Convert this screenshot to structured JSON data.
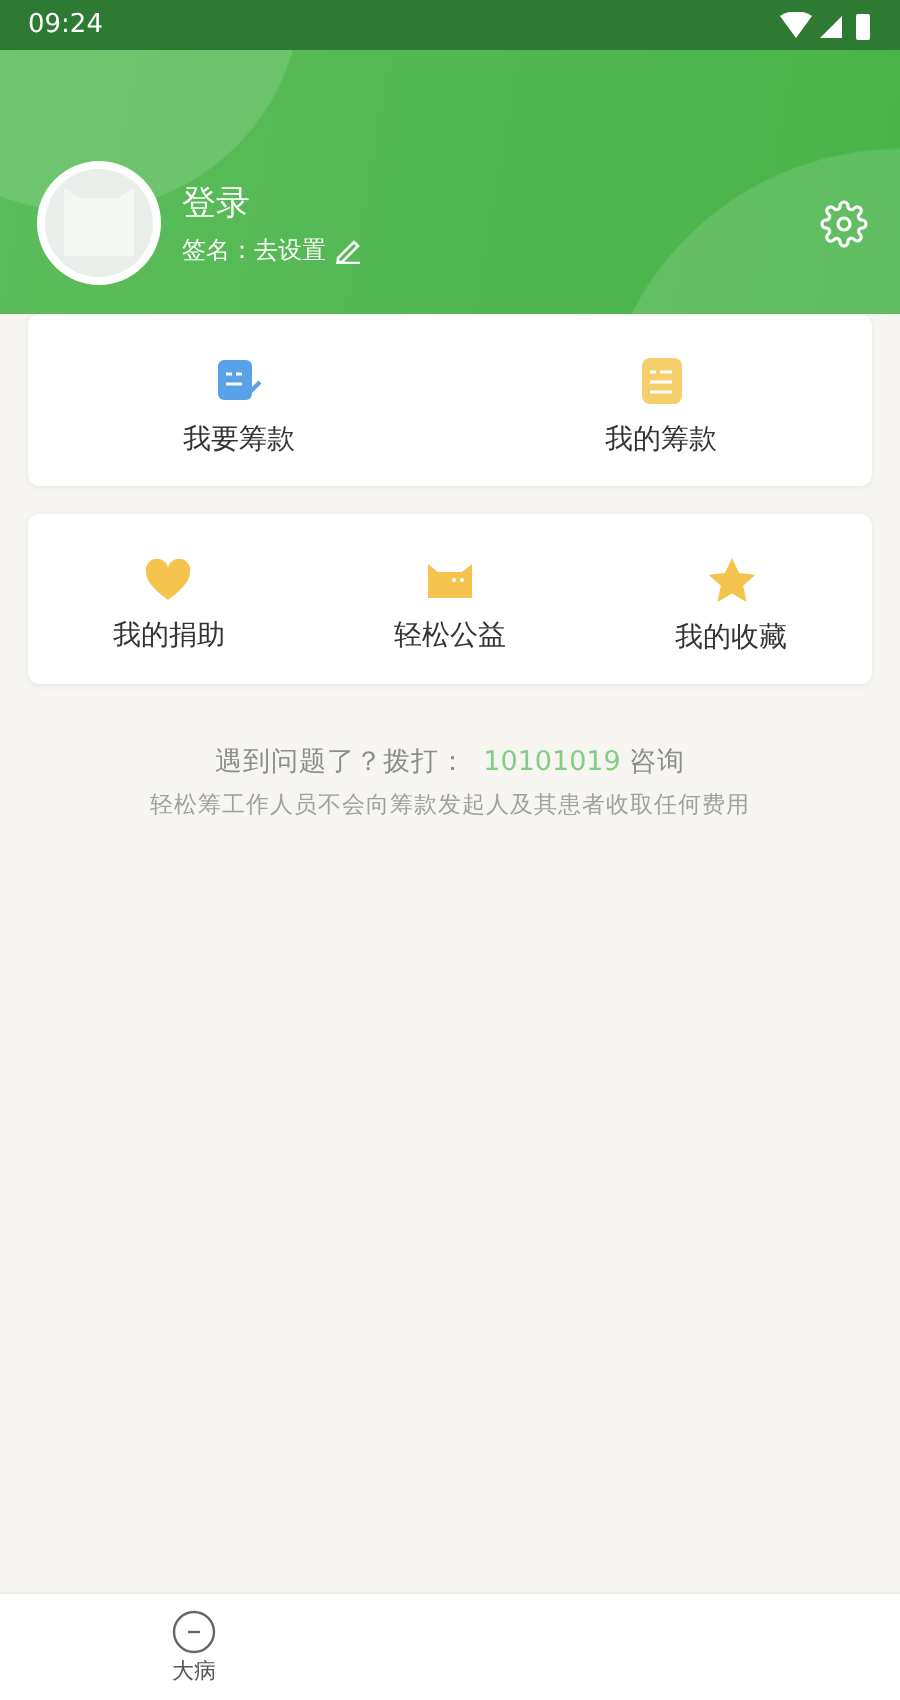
{
  "status_bar": {
    "time": "09:24"
  },
  "profile": {
    "name": "登录",
    "signature_label": "签名：",
    "signature_value": "去设置"
  },
  "fundraise_actions": [
    {
      "label": "我要筹款",
      "kind": "write"
    },
    {
      "label": "我的筹款",
      "kind": "list"
    }
  ],
  "shortcuts": [
    {
      "label": "我的捐助",
      "kind": "heart"
    },
    {
      "label": "轻松公益",
      "kind": "cat"
    },
    {
      "label": "我的收藏",
      "kind": "star"
    }
  ],
  "help": {
    "prefix": "遇到问题了？拨打：",
    "phone": "10101019",
    "suffix": "咨询",
    "notice": "轻松筹工作人员不会向筹款发起人及其患者收取任何费用"
  },
  "bottom_nav": [
    {
      "label": "大病"
    }
  ]
}
